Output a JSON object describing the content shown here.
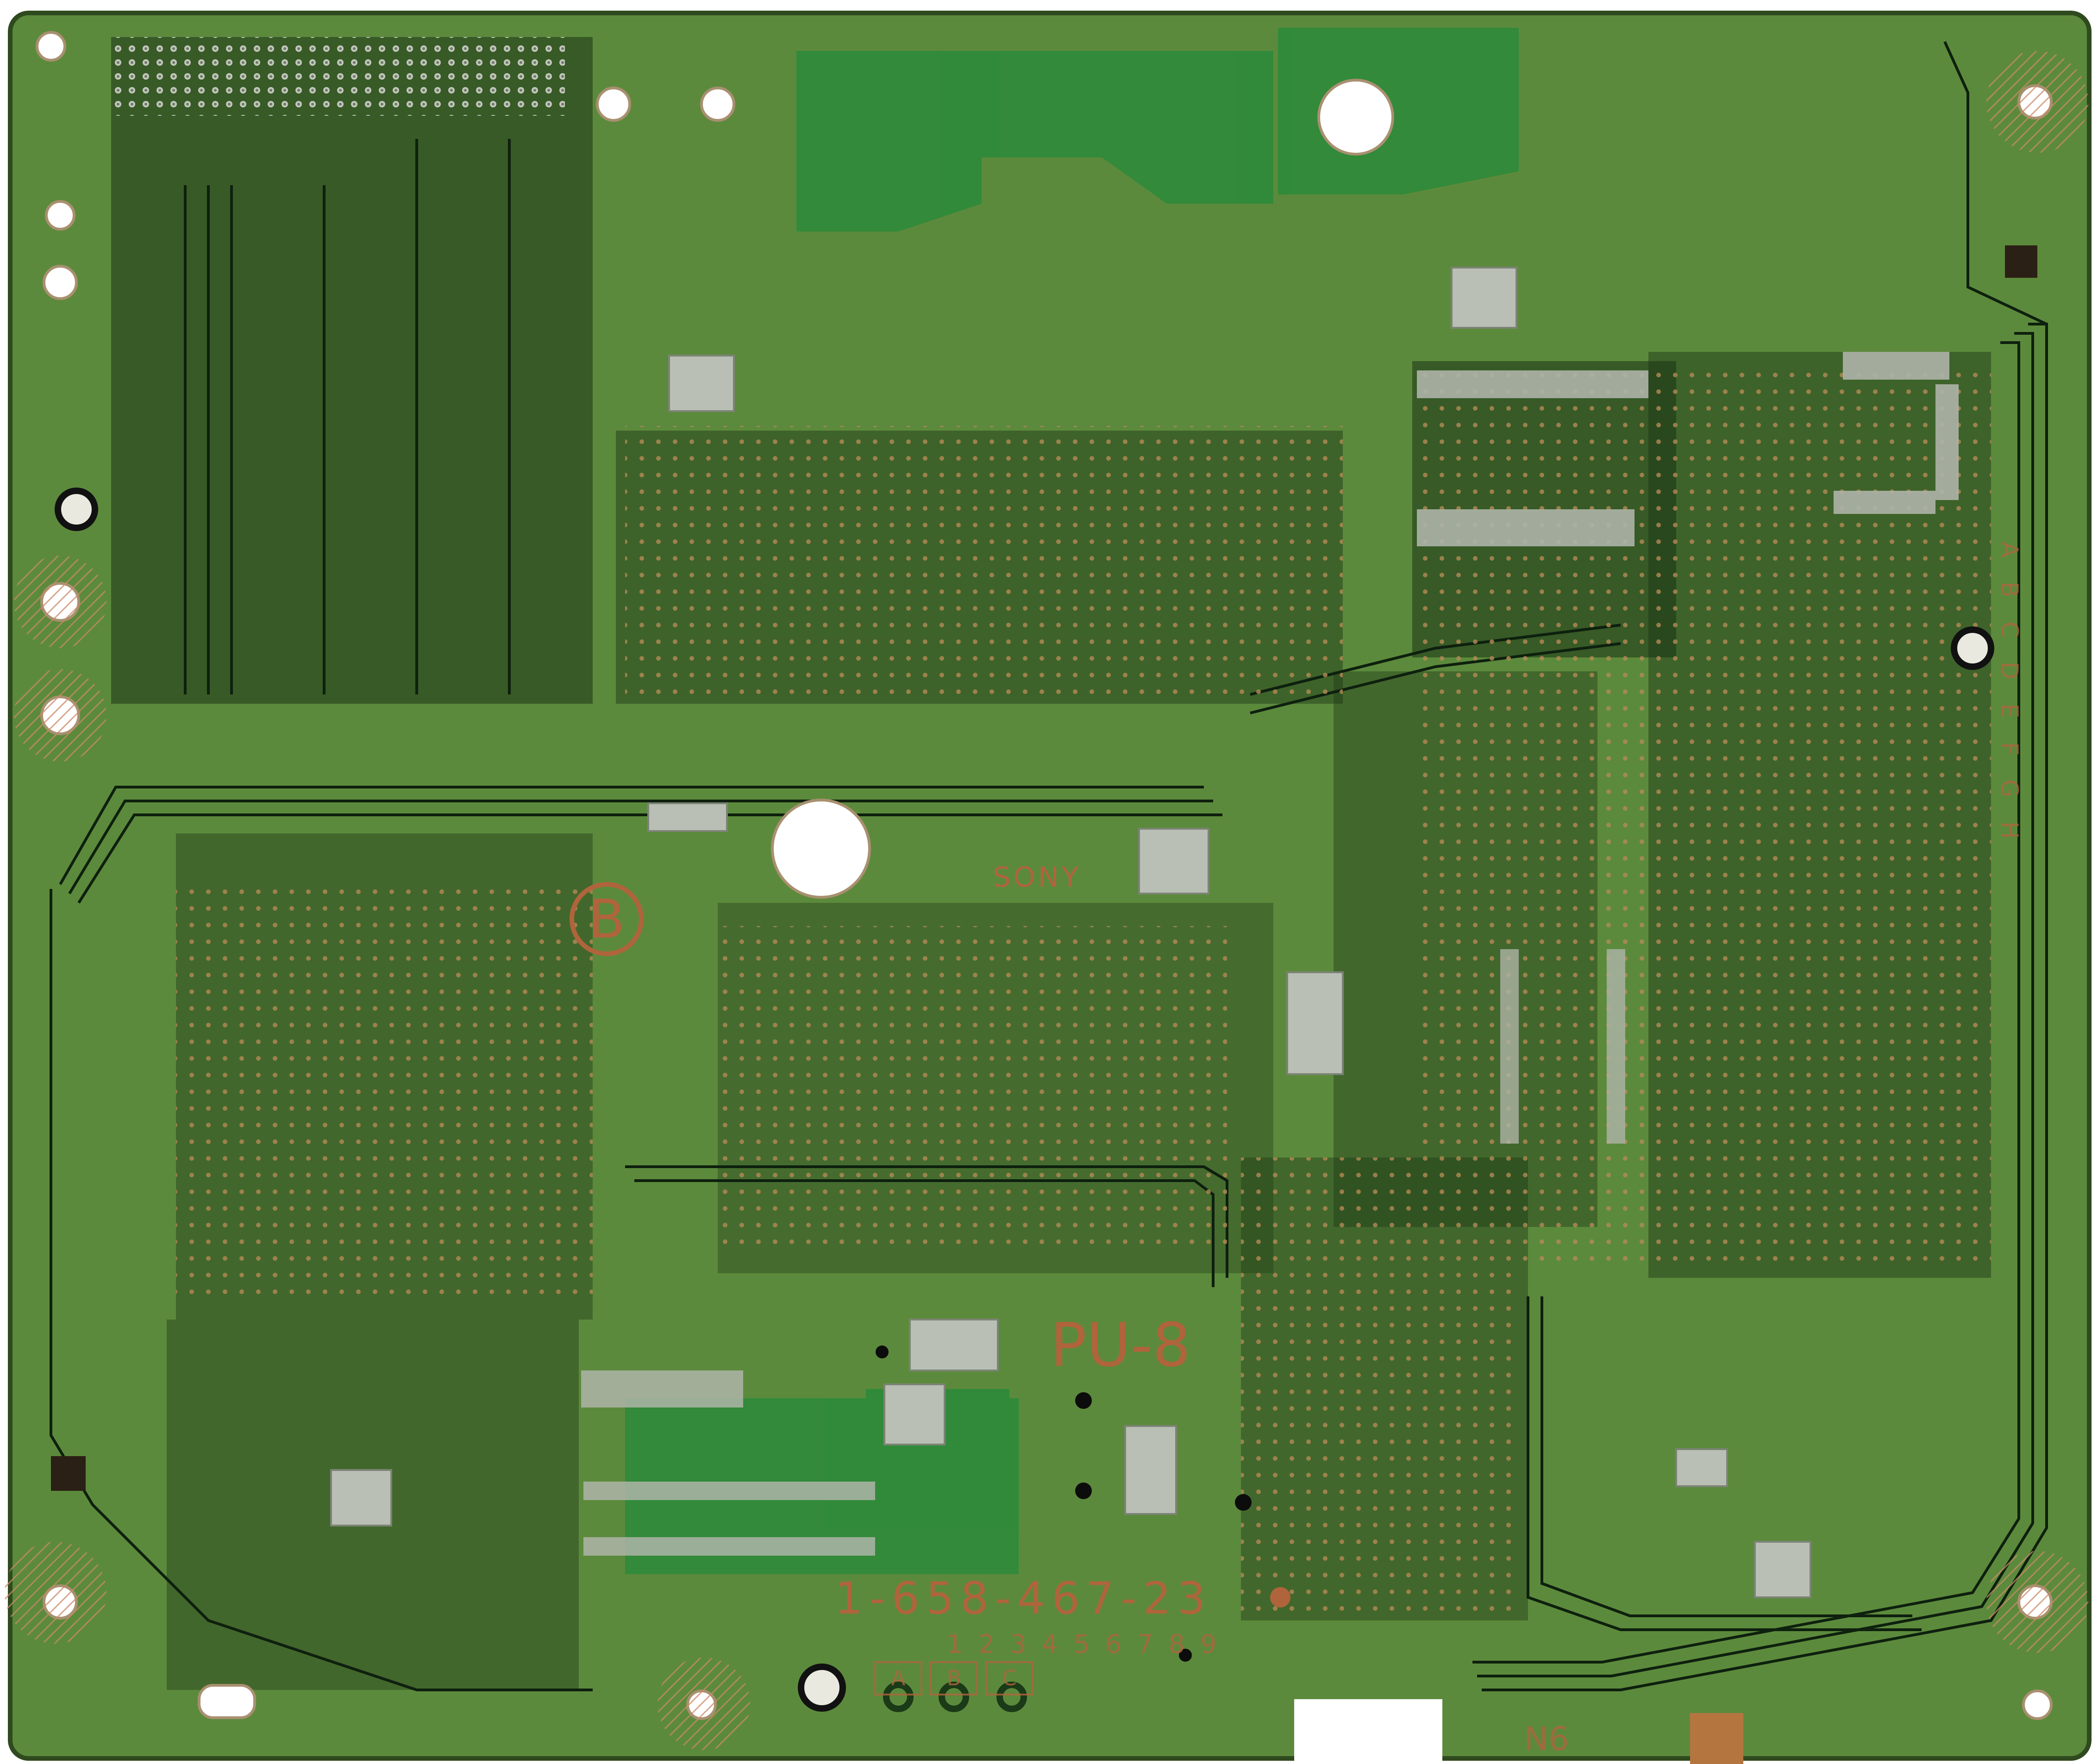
{
  "scene": "bare printed circuit board, solder side",
  "colors": {
    "board_green": "#5c8a3c",
    "board_edge": "#2f4a1e",
    "trace_dark": "#0f2410",
    "pad_silver": "#b9bfb4",
    "silkscreen_copper": "#b0643c",
    "bright_green_fill": "#1f9a3c",
    "hole_white": "#ffffff"
  },
  "silkscreen": {
    "brand": "SONY",
    "board_code": "PU-8",
    "part_number": "1-658-467-23",
    "column_numbers": "1 2 3 4 5 6 7 8 9",
    "row_letters_right": "A B C D E F G H",
    "abc_labels": [
      "A",
      "B",
      "C"
    ],
    "corner_code": "N6",
    "circle_letter": "B"
  }
}
